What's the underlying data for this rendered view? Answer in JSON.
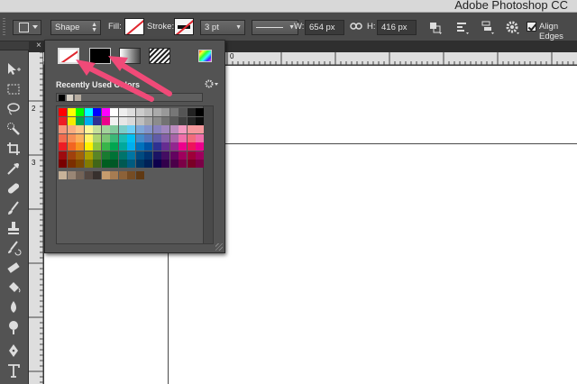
{
  "window": {
    "title": "Adobe Photoshop CC"
  },
  "options_bar": {
    "mode": "Shape",
    "fill_label": "Fill:",
    "stroke_label": "Stroke:",
    "stroke_width": "3 pt",
    "width_label": "W:",
    "width_value": "654 px",
    "height_label": "H:",
    "height_value": "416 px",
    "align_edges_label": "Align Edges",
    "align_edges_checked": true
  },
  "document": {
    "close_glyph": "×",
    "ruler_top": [
      "0"
    ],
    "ruler_left": [
      "2",
      "3"
    ]
  },
  "popup": {
    "recent_label": "Recently Used Colors",
    "fill_types": [
      "no-color",
      "solid-color",
      "gradient",
      "pattern",
      "color-picker"
    ],
    "recent_colors": [
      "#000000",
      "#d9d2c7",
      "#b7ada1"
    ],
    "swatch_rows": [
      [
        "#ff0000",
        "#ffff00",
        "#00ff00",
        "#00ffff",
        "#0000ff",
        "#ff00ff",
        "#ffffff",
        "#eeeeee",
        "#dddddd",
        "#cccccc",
        "#bbbbbb",
        "#aaaaaa",
        "#999999",
        "#777777",
        "#555555",
        "#222222",
        "#000000"
      ],
      [
        "#ee1d24",
        "#f5eb00",
        "#00a54f",
        "#00adef",
        "#2e3192",
        "#ec008c",
        "#f2f2f2",
        "#e6e6e6",
        "#d9d9d9",
        "#bfbfbf",
        "#a6a6a6",
        "#8c8c8c",
        "#737373",
        "#595959",
        "#404040",
        "#262626",
        "#0d0d0d"
      ],
      [
        "#f7977a",
        "#f9ad81",
        "#fdc68a",
        "#fff79a",
        "#c4df9b",
        "#a3d39c",
        "#82ca9d",
        "#7bcdc8",
        "#6ecff6",
        "#7ea7d8",
        "#8493ca",
        "#8882be",
        "#a187be",
        "#bc8dbf",
        "#f49ac2",
        "#f6989d",
        "#f5989d"
      ],
      [
        "#f26c4f",
        "#f68e55",
        "#fbaf5c",
        "#fff467",
        "#acd372",
        "#7cc576",
        "#3bb878",
        "#1abbb4",
        "#00bff3",
        "#448ccb",
        "#5674b9",
        "#605ca8",
        "#8560a8",
        "#a864a8",
        "#f06eaa",
        "#f26d7d",
        "#f06eaa"
      ],
      [
        "#ed1c24",
        "#f26522",
        "#f7941d",
        "#fff200",
        "#8dc73f",
        "#39b54a",
        "#00a651",
        "#00a99d",
        "#00aeef",
        "#0072bc",
        "#0054a6",
        "#2e3192",
        "#662d91",
        "#92278f",
        "#ec008c",
        "#ed145b",
        "#ec008c"
      ],
      [
        "#9e0b0f",
        "#a0410d",
        "#a36209",
        "#aba000",
        "#598527",
        "#197b30",
        "#007236",
        "#00746b",
        "#0076a3",
        "#004b80",
        "#003471",
        "#1b1464",
        "#440e62",
        "#630460",
        "#9e005d",
        "#9e0039",
        "#9e005d"
      ],
      [
        "#790000",
        "#7b2e00",
        "#7d4900",
        "#827b00",
        "#406618",
        "#005e20",
        "#005826",
        "#005952",
        "#005b7f",
        "#003663",
        "#002157",
        "#0d004c",
        "#32004b",
        "#4b0049",
        "#7b0046",
        "#7a0026",
        "#7b0046"
      ],
      [
        "#c7b299",
        "#998675",
        "#736357",
        "#534741",
        "#37302d",
        "#c69c6d",
        "#a67c52",
        "#8c6239",
        "#754c24",
        "#603913"
      ]
    ]
  },
  "icons": {
    "link": "link-chain-icon",
    "gear": "gear-icon",
    "align": "path-alignment-icon"
  }
}
